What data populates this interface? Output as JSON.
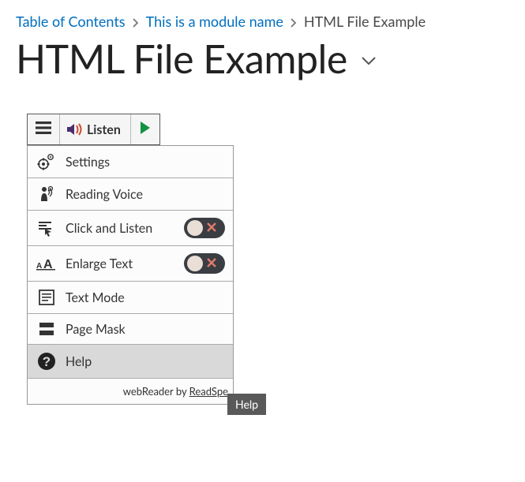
{
  "breadcrumb": {
    "toc": "Table of Contents",
    "module": "This is a module name",
    "current": "HTML File Example"
  },
  "page": {
    "title": "HTML File Example"
  },
  "reader": {
    "listen_label": "Listen",
    "menu": {
      "settings": "Settings",
      "reading_voice": "Reading Voice",
      "click_listen": "Click and Listen",
      "enlarge_text": "Enlarge Text",
      "text_mode": "Text Mode",
      "page_mask": "Page Mask",
      "help": "Help"
    },
    "footer_prefix": "webReader by ",
    "footer_brand": "ReadSpe",
    "tooltip": "Help"
  }
}
